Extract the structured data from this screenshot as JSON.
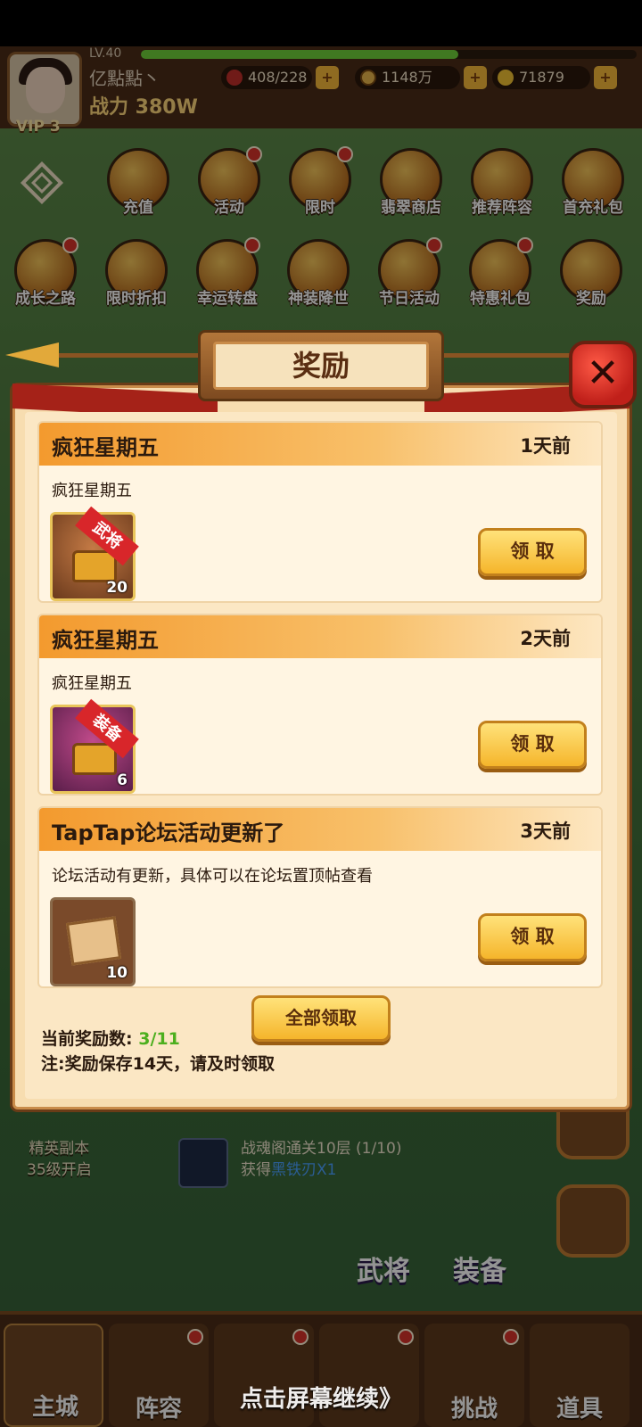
{
  "player": {
    "level": "LV.40",
    "name": "亿點點丶",
    "power": "战力 380W",
    "vip": "VIP 3",
    "level_progress": 0.64
  },
  "resources": [
    {
      "icon": "stamina-icon",
      "value": "408/228"
    },
    {
      "icon": "coin-icon",
      "value": "1148万"
    },
    {
      "icon": "ingot-icon",
      "value": "71879"
    }
  ],
  "menu_row1": [
    "充值",
    "活动",
    "限时",
    "翡翠商店",
    "推荐阵容",
    "首充礼包"
  ],
  "menu_row2": [
    "成长之路",
    "限时折扣",
    "幸运转盘",
    "神装降世",
    "节日活动",
    "特惠礼包",
    "奖励"
  ],
  "modal": {
    "title": "奖励",
    "close": "✕",
    "mails": [
      {
        "title": "疯狂星期五",
        "time": "1天前",
        "body": "疯狂星期五",
        "item_tag": "武将",
        "item_qty": "20",
        "claim": "领 取"
      },
      {
        "title": "疯狂星期五",
        "time": "2天前",
        "body": "疯狂星期五",
        "item_tag": "装备",
        "item_qty": "6",
        "claim": "领 取"
      },
      {
        "title": "TapTap论坛活动更新了",
        "time": "3天前",
        "body": "论坛活动有更新，具体可以在论坛置顶帖查看",
        "item_qty": "10",
        "claim": "领 取"
      }
    ],
    "claim_all": "全部领取",
    "count_label": "当前奖励数:",
    "count_value": "3/11",
    "note": "注:奖励保存14天，请及时领取"
  },
  "scene": {
    "elite_line1": "精英副本",
    "elite_line2": "35级开启",
    "quest_line1": "战魂阁通关10层 (1/10)",
    "quest_prefix": "获得",
    "quest_reward": "黑铁刃X1",
    "word_general": "武将",
    "word_equip": "装备"
  },
  "bottom_nav": [
    "主城",
    "阵容",
    "",
    "",
    "挑战",
    "道具"
  ],
  "continue_hint": "点击屏幕继续》"
}
